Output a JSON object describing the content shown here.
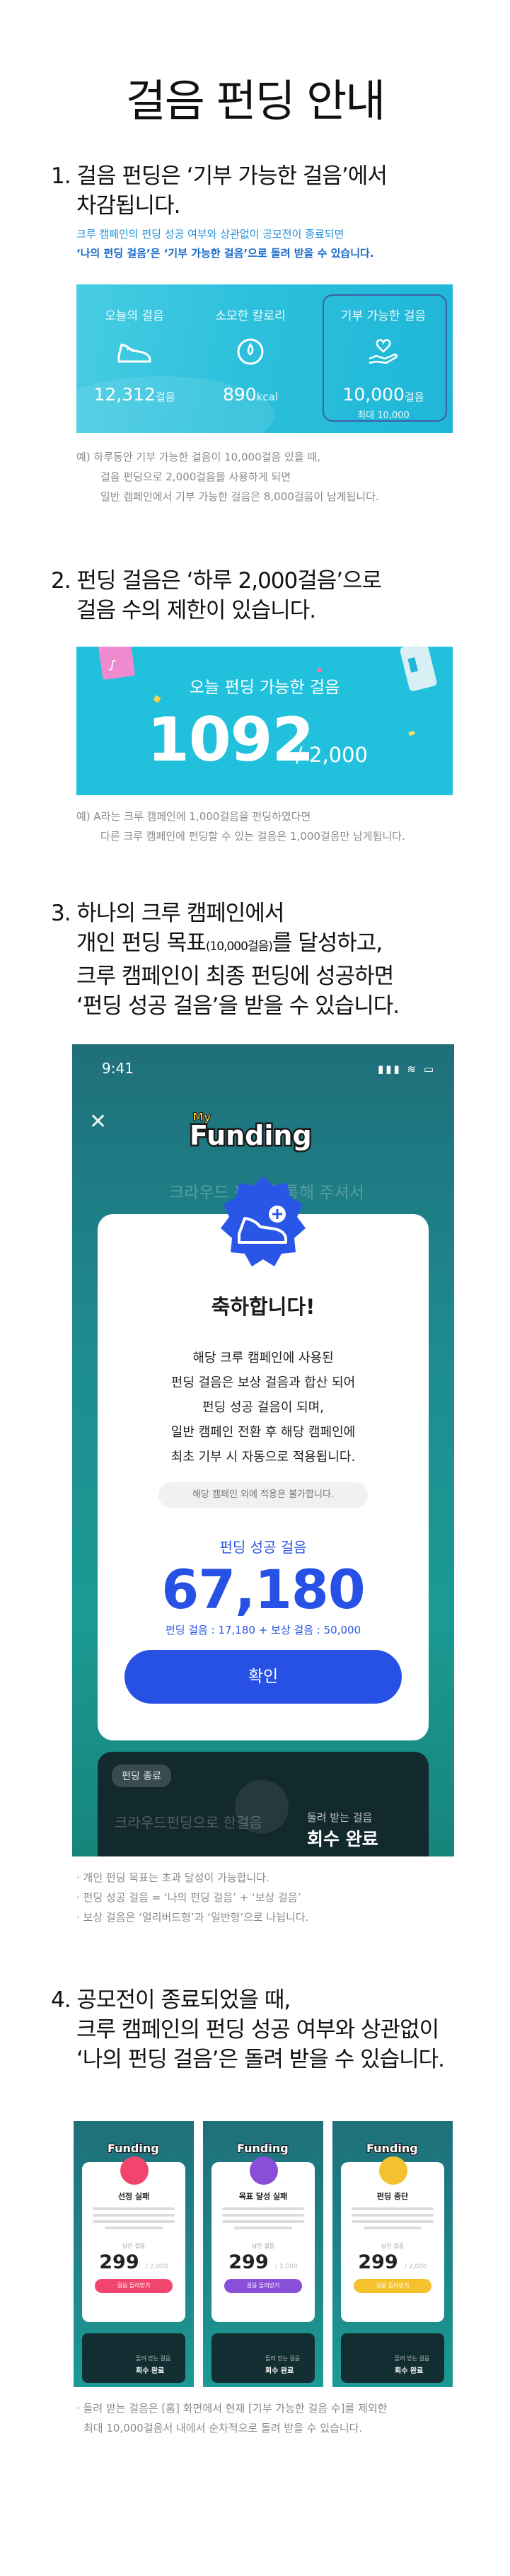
{
  "page": {
    "title": "걸음 펀딩 안내"
  },
  "section1": {
    "heading_line1": "1. 걸음 펀딩은 ‘기부 가능한 걸음’에서",
    "heading_line2": "차감됩니다.",
    "note_line1": "크루 캠페인의 펀딩 성공 여부와 상관없이 공모전이 종료되면",
    "note_line2": "‘나의 펀딩 걸음’은 ‘기부 가능한 걸음’으로 돌려 받을 수 있습니다.",
    "stats": [
      {
        "label": "오늘의 걸음",
        "value": "12,312",
        "unit": "걸음",
        "icon": "shoe-icon"
      },
      {
        "label": "소모한 칼로리",
        "value": "890",
        "unit": "kcal",
        "icon": "calorie-icon"
      },
      {
        "label": "기부 가능한 걸음",
        "value": "10,000",
        "unit": "걸음",
        "caption": "최대 10,000",
        "icon": "heart-hand-icon"
      }
    ],
    "example_line1": "예) 하루동안 기부 가능한 걸음이 10,000걸음 있을 때,",
    "example_line2": "걸음 펀딩으로 2,000걸음을 사용하게 되면",
    "example_line3": "일반 캠페인에서 기부 가능한 걸음은 8,000걸음이 남게됩니다."
  },
  "section2": {
    "heading_line1": "2. 펀딩 걸음은 ‘하루 2,000걸음’으로",
    "heading_line2": "걸음 수의 제한이 있습니다.",
    "banner_label": "오늘 펀딩 가능한 걸음",
    "banner_value": "1092",
    "banner_total": "/ 2,000",
    "example_line1": "예) A라는 크루 캠페인에 1,000걸음을 펀딩하였다면",
    "example_line2": "다른 크루 캠페인에 펀딩할 수 있는 걸음은 1,000걸음만 남게됩니다."
  },
  "section3": {
    "heading_line1": "3. 하나의 크루 캠페인에서",
    "heading_line2a": "개인 펀딩 목표",
    "heading_line2b": "(10,000걸음)",
    "heading_line2c": "를 달성하고,",
    "heading_line3": "크루 캠페인이 최종 펀딩에 성공하면",
    "heading_line4": "‘펀딩 성공 걸음’을 받을 수 있습니다.",
    "phone": {
      "time": "9:41",
      "status_icons": "▮▮▮ ≋ ▭",
      "logo_small": "My",
      "logo": "Funding",
      "behind_text": "크라우드 펀딩을 통해 주셔서",
      "modal_title": "축하합니다!",
      "modal_body": [
        "해당 크루 캠페인에 사용된",
        "펀딩 걸음은 보상 걸음과 합산 되어",
        "펀딩 성공 걸음이 되며,",
        "일반 캠페인 전환 후 해당 캠페인에",
        "최초 기부 시 자동으로 적용됩니다."
      ],
      "modal_footnote": "해당 캠페인 외에 적용은 불가합니다.",
      "amount_label": "펀딩 성공 걸음",
      "amount": "67,180",
      "breakdown": "펀딩 걸음 : 17,180 + 보상 걸음 : 50,000",
      "confirm": "확인",
      "chip": "펀딩 종료",
      "card_left": "크라우드펀딩으로 한걸음",
      "card_right_small": "돌려 받는 걸음",
      "card_right_big": "회수 완료"
    },
    "notes": [
      "· 개인 펀딩 목표는 초과 달성이 가능합니다.",
      "· 펀딩 성공 걸음 = ‘나의 펀딩 걸음’ + ‘보상 걸음’",
      "· 보상 걸음은 ‘얼리버드형’과 ‘일반형’으로 나뉩니다."
    ]
  },
  "section4": {
    "heading_line1": "4. 공모전이 종료되었을 때,",
    "heading_line2": "크루 캠페인의 펀딩 성공 여부와 상관없이",
    "heading_line3": "‘나의 펀딩 걸음’은 돌려 받을 수 있습니다.",
    "shots": [
      {
        "title": "선정 실패",
        "value": "299",
        "button": "걸음 돌려받기",
        "color": "#f2456d"
      },
      {
        "title": "목표 달성 실패",
        "value": "299",
        "button": "걸음 돌려받기",
        "color": "#8a4fd8"
      },
      {
        "title": "펀딩 중단",
        "value": "299",
        "button": "걸음 돌려받기",
        "color": "#f5c22f"
      }
    ],
    "shot_logo": "Funding",
    "shot_caption": "남은 걸음",
    "shot_unit": "/ 2,000",
    "shot_bottom_small": "돌려 받는 걸음",
    "shot_bottom_big": "회수 완료",
    "note_line1": "· 돌려 받는 걸음은 [홈] 화면에서 현재 [기부 가능한 걸음 수]를 제외한",
    "note_line2": "최대 10,000걸음서 내에서 순차적으로 돌려 받을 수 있습니다."
  },
  "colors": {
    "accent_blue": "#2750e5",
    "cyan": "#21c1dd",
    "note_blue": "#1e8fdc",
    "teal_bg": "#1d8d91"
  }
}
